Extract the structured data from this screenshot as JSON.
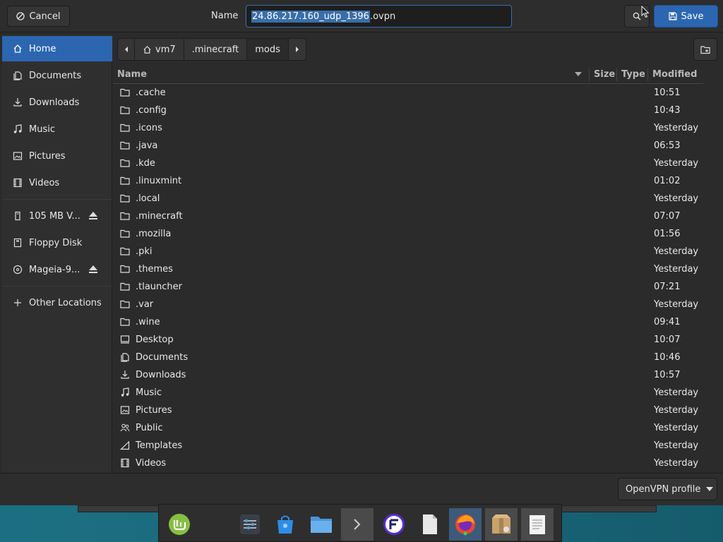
{
  "header": {
    "cancel_label": "Cancel",
    "name_label": "Name",
    "filename_selected": "24.86.217.160_udp_1396",
    "filename_ext": ".ovpn",
    "save_label": "Save"
  },
  "sidebar": {
    "items": [
      {
        "label": "Home",
        "icon": "home-icon"
      },
      {
        "label": "Documents",
        "icon": "documents-icon"
      },
      {
        "label": "Downloads",
        "icon": "downloads-icon"
      },
      {
        "label": "Music",
        "icon": "music-icon"
      },
      {
        "label": "Pictures",
        "icon": "pictures-icon"
      },
      {
        "label": "Videos",
        "icon": "videos-icon"
      },
      {
        "label": "105 MB V...",
        "icon": "drive-icon"
      },
      {
        "label": "Floppy Disk",
        "icon": "floppy-icon"
      },
      {
        "label": "Mageia-9...",
        "icon": "disc-icon"
      },
      {
        "label": "Other Locations",
        "icon": "plus-icon"
      }
    ]
  },
  "pathbar": {
    "crumbs": [
      "vm7",
      ".minecraft",
      "mods"
    ]
  },
  "columns": {
    "name": "Name",
    "size": "Size",
    "type": "Type",
    "modified": "Modified"
  },
  "files": [
    {
      "name": ".cache",
      "modified": "10:51"
    },
    {
      "name": ".config",
      "modified": "10:43"
    },
    {
      "name": ".icons",
      "modified": "Yesterday"
    },
    {
      "name": ".java",
      "modified": "06:53"
    },
    {
      "name": ".kde",
      "modified": "Yesterday"
    },
    {
      "name": ".linuxmint",
      "modified": "01:02"
    },
    {
      "name": ".local",
      "modified": "Yesterday"
    },
    {
      "name": ".minecraft",
      "modified": "07:07"
    },
    {
      "name": ".mozilla",
      "modified": "01:56"
    },
    {
      "name": ".pki",
      "modified": "Yesterday"
    },
    {
      "name": ".themes",
      "modified": "Yesterday"
    },
    {
      "name": ".tlauncher",
      "modified": "07:21"
    },
    {
      "name": ".var",
      "modified": "Yesterday"
    },
    {
      "name": ".wine",
      "modified": "09:41"
    },
    {
      "name": "Desktop",
      "modified": "10:07"
    },
    {
      "name": "Documents",
      "modified": "10:46"
    },
    {
      "name": "Downloads",
      "modified": "10:57"
    },
    {
      "name": "Music",
      "modified": "Yesterday"
    },
    {
      "name": "Pictures",
      "modified": "Yesterday"
    },
    {
      "name": "Public",
      "modified": "Yesterday"
    },
    {
      "name": "Templates",
      "modified": "Yesterday"
    },
    {
      "name": "Videos",
      "modified": "Yesterday"
    }
  ],
  "filter": {
    "selected": "OpenVPN profile"
  },
  "colors": {
    "accent": "#2c66b0",
    "background": "#2b2b2b"
  }
}
